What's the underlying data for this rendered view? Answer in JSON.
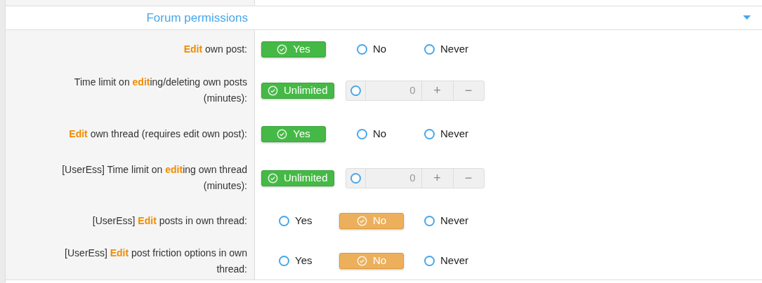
{
  "section": {
    "title": "Forum permissions",
    "expanded": true
  },
  "rows": [
    {
      "kind": "choice",
      "label": "**Edit** own post:",
      "options": [
        {
          "label": "Yes",
          "selected": true
        },
        {
          "label": "No",
          "selected": false
        },
        {
          "label": "Never",
          "selected": false
        }
      ]
    },
    {
      "kind": "limit",
      "label": "Time limit on **edit**ing/deleting own posts (minutes):",
      "unlimited": {
        "label": "Unlimited",
        "selected": true
      },
      "custom": {
        "value": "0",
        "selected": false,
        "increment": "+",
        "decrement": "−"
      }
    },
    {
      "kind": "choice",
      "label": "**Edit** own thread (requires edit own post):",
      "options": [
        {
          "label": "Yes",
          "selected": true
        },
        {
          "label": "No",
          "selected": false
        },
        {
          "label": "Never",
          "selected": false
        }
      ]
    },
    {
      "kind": "limit",
      "label": "[UserEss] Time limit on **edit**ing own thread (minutes):",
      "unlimited": {
        "label": "Unlimited",
        "selected": true
      },
      "custom": {
        "value": "0",
        "selected": false,
        "increment": "+",
        "decrement": "−"
      }
    },
    {
      "kind": "choice",
      "label": "[UserEss] **Edit** posts in own thread:",
      "options": [
        {
          "label": "Yes",
          "selected": false
        },
        {
          "label": "No",
          "selected": true
        },
        {
          "label": "Never",
          "selected": false
        }
      ]
    },
    {
      "kind": "choice",
      "label": "[UserEss] **Edit** post friction options in own thread:",
      "options": [
        {
          "label": "Yes",
          "selected": false
        },
        {
          "label": "No",
          "selected": true
        },
        {
          "label": "Never",
          "selected": false
        }
      ]
    }
  ]
}
